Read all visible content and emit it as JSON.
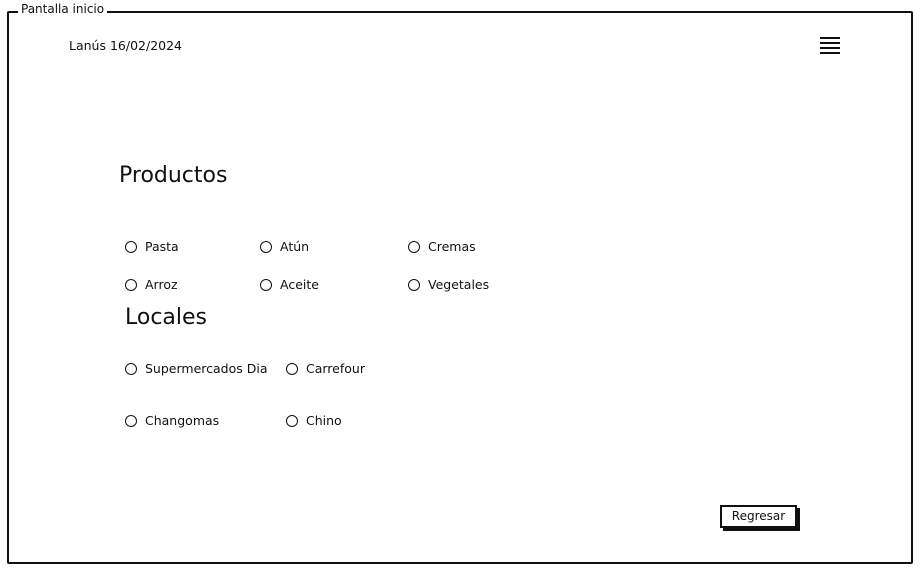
{
  "window": {
    "title": "Pantalla inicio"
  },
  "header": {
    "location_date": "Lanús 16/02/2024",
    "menu_icon": "hamburger-menu-icon"
  },
  "productos": {
    "title": "Productos",
    "options": [
      {
        "label": "Pasta",
        "selected": false
      },
      {
        "label": "Atún",
        "selected": false
      },
      {
        "label": "Cremas",
        "selected": false
      },
      {
        "label": "Arroz",
        "selected": false
      },
      {
        "label": "Aceite",
        "selected": false
      },
      {
        "label": "Vegetales",
        "selected": false
      }
    ]
  },
  "locales": {
    "title": "Locales",
    "options": [
      {
        "label": "Supermercados Dia",
        "selected": false
      },
      {
        "label": "Carrefour",
        "selected": false
      },
      {
        "label": "Changomas",
        "selected": false
      },
      {
        "label": "Chino",
        "selected": false
      }
    ]
  },
  "actions": {
    "back_label": "Regresar"
  }
}
